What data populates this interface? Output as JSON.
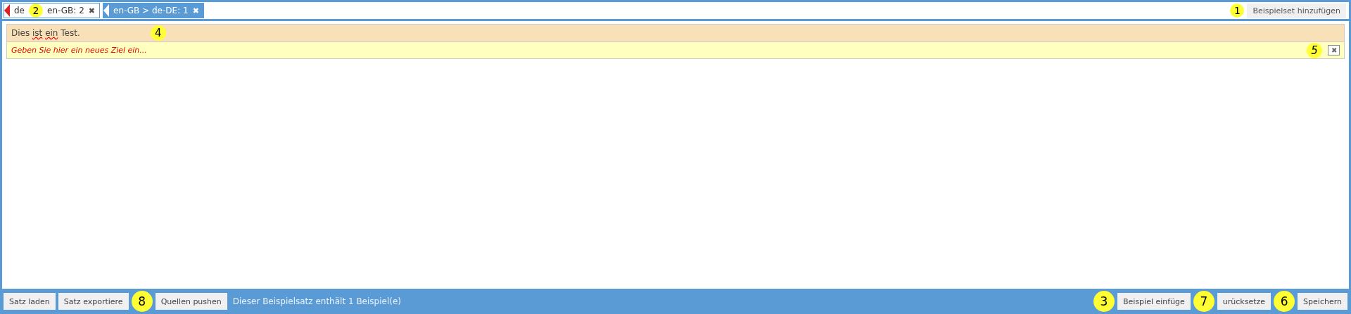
{
  "toolbar": {
    "tags": [
      {
        "kind": "source",
        "parts": [
          "de",
          "en-GB: 2"
        ],
        "callout": "2",
        "close": "✖",
        "color": "#e02020"
      },
      {
        "kind": "target",
        "parts": [
          "en-GB > de-DE: 1"
        ],
        "close": "✖",
        "color": "#ffffff"
      }
    ],
    "callout": "1",
    "add_button": "Beispielset hinzufügen"
  },
  "examples": [
    {
      "source": "Dies **ist** **ein** Test.",
      "source_callout": "4",
      "target_placeholder": "Geben Sie hier ein neues Ziel ein...",
      "remove_callout": "5",
      "remove": "✖"
    }
  ],
  "footer": {
    "left": [
      {
        "kind": "button",
        "text": "Satz laden"
      },
      {
        "kind": "button",
        "text": "Satz exportiere"
      },
      {
        "kind": "callout",
        "text": "8"
      },
      {
        "kind": "button",
        "text": "Quellen pushen"
      }
    ],
    "status": "Dieser Beispielsatz enthält 1 Beispiel(e)",
    "right": [
      {
        "kind": "callout",
        "text": "3"
      },
      {
        "kind": "button",
        "text": "Beispiel einfüge"
      },
      {
        "kind": "callout",
        "text": "7"
      },
      {
        "kind": "button",
        "text": "urücksetze"
      },
      {
        "kind": "callout",
        "text": "6"
      },
      {
        "kind": "button",
        "text": "Speichern"
      }
    ]
  }
}
